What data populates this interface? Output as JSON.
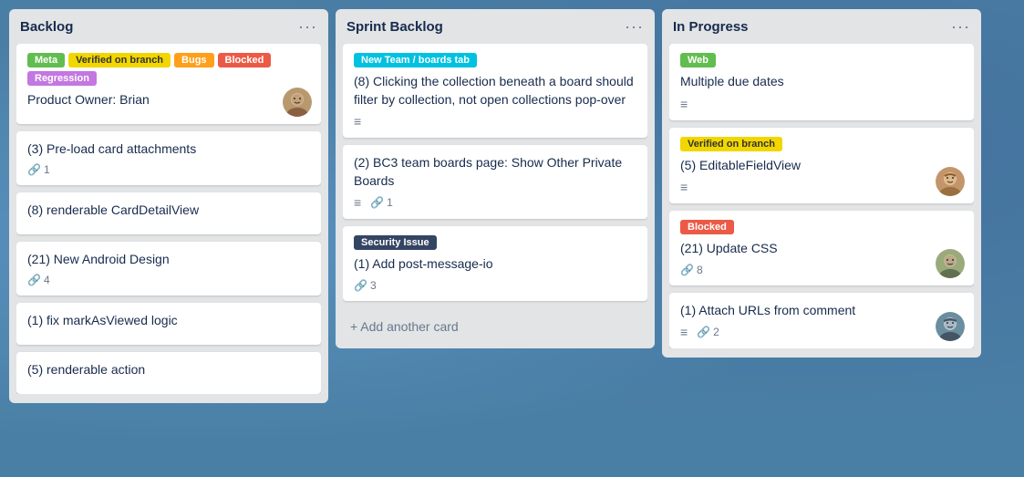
{
  "columns": [
    {
      "id": "backlog",
      "title": "Backlog",
      "menu": "···",
      "cards": [
        {
          "id": "card-1",
          "labels": [
            {
              "text": "Meta",
              "class": "label-green"
            },
            {
              "text": "Verified on branch",
              "class": "label-yellow"
            },
            {
              "text": "Bugs",
              "class": "label-orange"
            },
            {
              "text": "Blocked",
              "class": "label-red"
            },
            {
              "text": "Regression",
              "class": "label-purple"
            }
          ],
          "title": "Product Owner: Brian",
          "meta": [],
          "avatar": "brian",
          "has_avatar": true
        },
        {
          "id": "card-2",
          "labels": [],
          "title": "(3) Pre-load card attachments",
          "meta": [
            {
              "type": "attach",
              "icon": "📎",
              "count": "1"
            }
          ],
          "has_avatar": false
        },
        {
          "id": "card-3",
          "labels": [],
          "title": "(8) renderable CardDetailView",
          "meta": [],
          "has_avatar": false
        },
        {
          "id": "card-4",
          "labels": [],
          "title": "(21) New Android Design",
          "meta": [
            {
              "type": "attach",
              "icon": "📎",
              "count": "4"
            }
          ],
          "has_avatar": false
        },
        {
          "id": "card-5",
          "labels": [],
          "title": "(1) fix markAsViewed logic",
          "meta": [],
          "has_avatar": false
        },
        {
          "id": "card-6",
          "labels": [],
          "title": "(5) renderable action",
          "meta": [],
          "has_avatar": false
        }
      ]
    },
    {
      "id": "sprint-backlog",
      "title": "Sprint Backlog",
      "menu": "···",
      "cards": [
        {
          "id": "card-7",
          "labels": [
            {
              "text": "New Team / boards tab",
              "class": "label-cyan"
            }
          ],
          "title": "(8) Clicking the collection beneath a board should filter by collection, not open collections pop-over",
          "meta": [
            {
              "type": "menu",
              "icon": "≡"
            }
          ],
          "has_avatar": false
        },
        {
          "id": "card-8",
          "labels": [],
          "title": "(2) BC3 team boards page: Show Other Private Boards",
          "meta": [
            {
              "type": "menu",
              "icon": "≡"
            },
            {
              "type": "attach",
              "icon": "📎",
              "count": "1"
            }
          ],
          "has_avatar": false
        },
        {
          "id": "card-9",
          "labels": [
            {
              "text": "Security Issue",
              "class": "label-dark"
            }
          ],
          "title": "(1) Add post-message-io",
          "meta": [
            {
              "type": "attach",
              "icon": "📎",
              "count": "3"
            }
          ],
          "has_avatar": false
        }
      ],
      "add_card_label": "+ Add another card"
    },
    {
      "id": "in-progress",
      "title": "In Progress",
      "menu": "···",
      "cards": [
        {
          "id": "card-10",
          "labels": [
            {
              "text": "Web",
              "class": "label-green"
            }
          ],
          "title": "Multiple due dates",
          "meta": [
            {
              "type": "menu",
              "icon": "≡"
            }
          ],
          "has_avatar": false
        },
        {
          "id": "card-11",
          "labels": [
            {
              "text": "Verified on branch",
              "class": "label-yellow"
            }
          ],
          "title": "(5) EditableFieldView",
          "meta": [
            {
              "type": "menu",
              "icon": "≡"
            }
          ],
          "avatar": "woman",
          "has_avatar": true
        },
        {
          "id": "card-12",
          "labels": [
            {
              "text": "Blocked",
              "class": "label-red"
            }
          ],
          "title": "(21) Update CSS",
          "meta": [
            {
              "type": "attach",
              "icon": "📎",
              "count": "8"
            }
          ],
          "avatar": "man1",
          "has_avatar": true
        },
        {
          "id": "card-13",
          "labels": [],
          "title": "(1) Attach URLs from comment",
          "meta": [
            {
              "type": "menu",
              "icon": "≡"
            },
            {
              "type": "attach",
              "icon": "📎",
              "count": "2"
            }
          ],
          "avatar": "man2",
          "has_avatar": true
        }
      ]
    }
  ]
}
